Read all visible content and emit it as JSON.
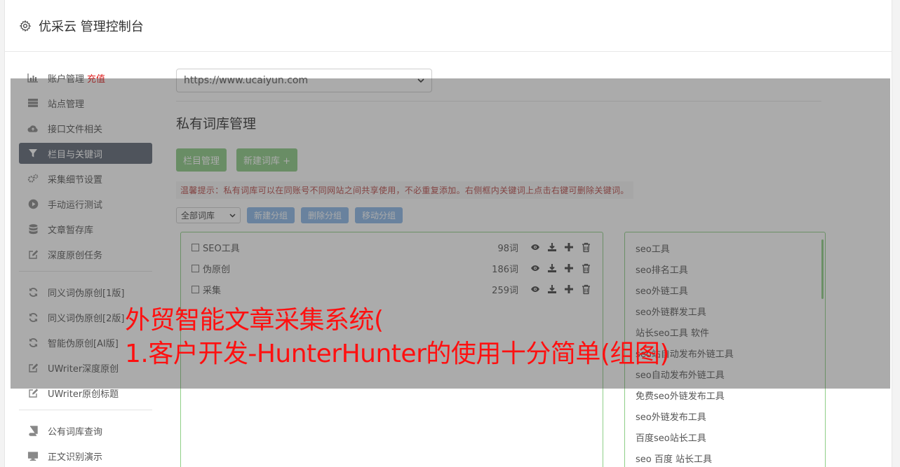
{
  "header": {
    "title": "优采云 管理控制台",
    "icon": "gear-icon"
  },
  "sidebar": {
    "group1": [
      {
        "label": "账户管理",
        "badge": "充值",
        "icon": "bar-chart-icon"
      },
      {
        "label": "站点管理",
        "icon": "server-icon"
      },
      {
        "label": "接口文件相关",
        "icon": "cloud-upload-icon"
      },
      {
        "label": "栏目与关键词",
        "icon": "filter-icon",
        "active": true
      },
      {
        "label": "采集细节设置",
        "icon": "gears-icon"
      },
      {
        "label": "手动运行测试",
        "icon": "play-circle-icon"
      },
      {
        "label": "文章暂存库",
        "icon": "database-icon"
      },
      {
        "label": "深度原创任务",
        "icon": "edit-icon"
      }
    ],
    "group2": [
      {
        "label": "同义词伪原创[1版]",
        "icon": "refresh-icon"
      },
      {
        "label": "同义词伪原创[2版]",
        "icon": "refresh-icon"
      },
      {
        "label": "智能伪原创[AI版]",
        "icon": "refresh-icon"
      },
      {
        "label": "UWriter深度原创",
        "icon": "edit-icon"
      },
      {
        "label": "UWriter原创标题",
        "icon": "edit-icon"
      }
    ],
    "group3": [
      {
        "label": "公有词库查询",
        "icon": "book-icon"
      },
      {
        "label": "正文识别演示",
        "icon": "monitor-icon"
      }
    ]
  },
  "main": {
    "site_select": "https://www.ucaiyun.com",
    "section_title": "私有词库管理",
    "buttons": {
      "column_manage": "栏目管理",
      "new_lib": "新建词库 +"
    },
    "tip": "温馨提示：私有词库可以在同账号不同网站之间共享使用，不必重复添加。右侧框内关键词上点击右键可删除关键词。",
    "filter_select": "全部词库",
    "group_buttons": {
      "new_group": "新建分组",
      "delete_group": "删除分组",
      "move_group": "移动分组"
    },
    "libraries": [
      {
        "name": "SEO工具",
        "count": "98词"
      },
      {
        "name": "伪原创",
        "count": "186词"
      },
      {
        "name": "采集",
        "count": "259词"
      }
    ],
    "keywords": [
      "seo工具",
      "seo排名工具",
      "seo外链工具",
      "seo外链群发工具",
      "站长seo工具 软件",
      "seo站自动发布外链工具",
      "seo自动发布外链工具",
      "免费seo外链发布工具",
      "seo外链发布工具",
      "百度seo站长工具",
      "seo 百度 站长工具"
    ]
  },
  "overlay_headline": {
    "line1": "外贸智能文章采集系统(",
    "line2": "1.客户开发-HunterHunter的使用十分简单(组图)"
  },
  "colors": {
    "active_nav": "#5d6675",
    "green": "#8ccb85",
    "blue": "#8bb8e8",
    "headline": "#ff1010"
  }
}
